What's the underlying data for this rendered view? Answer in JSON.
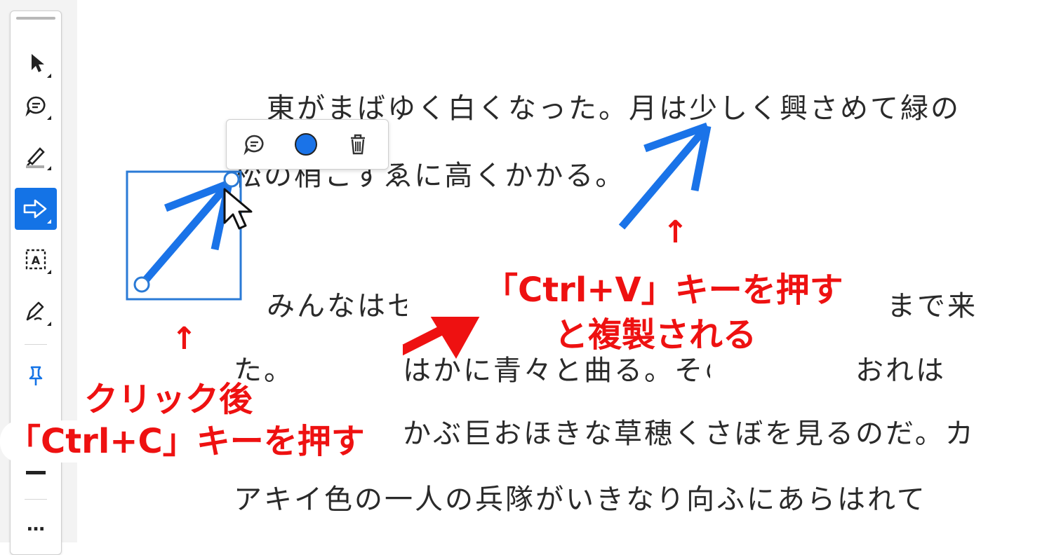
{
  "toolbar": {
    "tools": [
      {
        "name": "select-tool",
        "icon": "select-arrow-icon"
      },
      {
        "name": "comment-tool",
        "icon": "comment-bubble-icon"
      },
      {
        "name": "highlight-tool",
        "icon": "highlighter-icon"
      },
      {
        "name": "arrow-tool",
        "icon": "arrow-right-icon",
        "active": true
      },
      {
        "name": "text-box-tool",
        "icon": "text-box-icon"
      },
      {
        "name": "draw-tool",
        "icon": "pen-icon"
      },
      {
        "name": "pin-tool",
        "icon": "pushpin-icon"
      },
      {
        "name": "line-weight-tool",
        "icon": "line-weight-icon"
      },
      {
        "name": "more-tools",
        "icon": "more-icon"
      }
    ],
    "more_label": "…"
  },
  "annotation_popup": {
    "buttons": [
      {
        "name": "comment",
        "icon": "comment-bubble-icon"
      },
      {
        "name": "color",
        "icon": "color-dot-icon",
        "color": "#1a73e8"
      },
      {
        "name": "delete",
        "icon": "trash-icon"
      }
    ]
  },
  "document": {
    "lines": [
      "東がまばゆく白くなった。月は少しく興さめて緑の",
      "松の梢こずゑに高くかかる。",
      "みんなはセ",
      "まで来",
      "た。道",
      "はかに青々と曲る。その曲り角におれは",
      "かぶ巨おほきな草穂くさぼを見るのだ。カ",
      "アキイ色の一人の兵隊がいきなり向ふにあらはれて"
    ]
  },
  "callouts": {
    "copy_line1": "クリック後",
    "copy_line2": "「Ctrl+C」キーを押す",
    "paste_line1": "「Ctrl+V」キーを押す",
    "paste_line2": "と複製される",
    "up_arrow": "↑"
  },
  "colors": {
    "accent": "#1473e6",
    "annotation_arrow": "#1a73e8",
    "callout_red": "#ee1111"
  }
}
